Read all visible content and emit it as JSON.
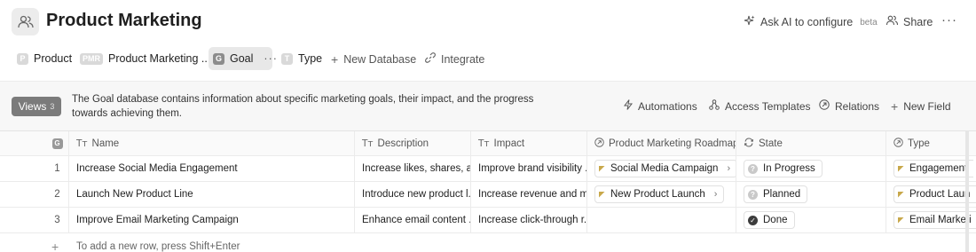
{
  "header": {
    "title": "Product Marketing",
    "app_icon": "people-icon",
    "ask_ai_label": "Ask AI to configure",
    "ask_ai_badge": "beta",
    "share_label": "Share",
    "more_label": "···"
  },
  "tabs": [
    {
      "badge": "P",
      "label": "Product",
      "active": false
    },
    {
      "badge": "PMR",
      "label": "Product Marketing ...",
      "active": false
    },
    {
      "badge": "G",
      "label": "Goal",
      "active": true,
      "more": "···"
    },
    {
      "badge": "T",
      "label": "Type",
      "active": false
    }
  ],
  "tab_actions": {
    "new_database": "New Database",
    "integrate": "Integrate"
  },
  "infobar": {
    "views_label": "Views",
    "views_count": "3",
    "description": "The Goal database contains information about specific marketing goals, their impact, and the progress towards achieving them.",
    "actions": {
      "automations": "Automations",
      "access_templates": "Access Templates",
      "relations": "Relations",
      "new_field": "New Field"
    }
  },
  "table": {
    "corner_badge": "G",
    "columns": [
      {
        "icon": "text-type-icon",
        "label": "Name"
      },
      {
        "icon": "text-type-icon",
        "label": "Description"
      },
      {
        "icon": "text-type-icon",
        "label": "Impact"
      },
      {
        "icon": "relation-icon",
        "label": "Product Marketing Roadmap"
      },
      {
        "icon": "state-icon",
        "label": "State"
      },
      {
        "icon": "relation-icon",
        "label": "Type"
      }
    ],
    "rows": [
      {
        "num": "1",
        "name": "Increase Social Media Engagement",
        "description": "Increase likes, shares, a...",
        "impact": "Improve brand visibility ...",
        "roadmap": "Social Media Campaign",
        "state": "In Progress",
        "state_icon": "question",
        "type": "Engagement"
      },
      {
        "num": "2",
        "name": "Launch New Product Line",
        "description": "Introduce new product l...",
        "impact": "Increase revenue and m...",
        "roadmap": "New Product Launch",
        "state": "Planned",
        "state_icon": "question",
        "type": "Product Laun"
      },
      {
        "num": "3",
        "name": "Improve Email Marketing Campaign",
        "description": "Enhance email content ...",
        "impact": "Increase click-through r...",
        "roadmap": "",
        "state": "Done",
        "state_icon": "check",
        "type": "Email Marketi"
      }
    ],
    "add_row_hint": "To add a new row, press Shift+Enter"
  }
}
